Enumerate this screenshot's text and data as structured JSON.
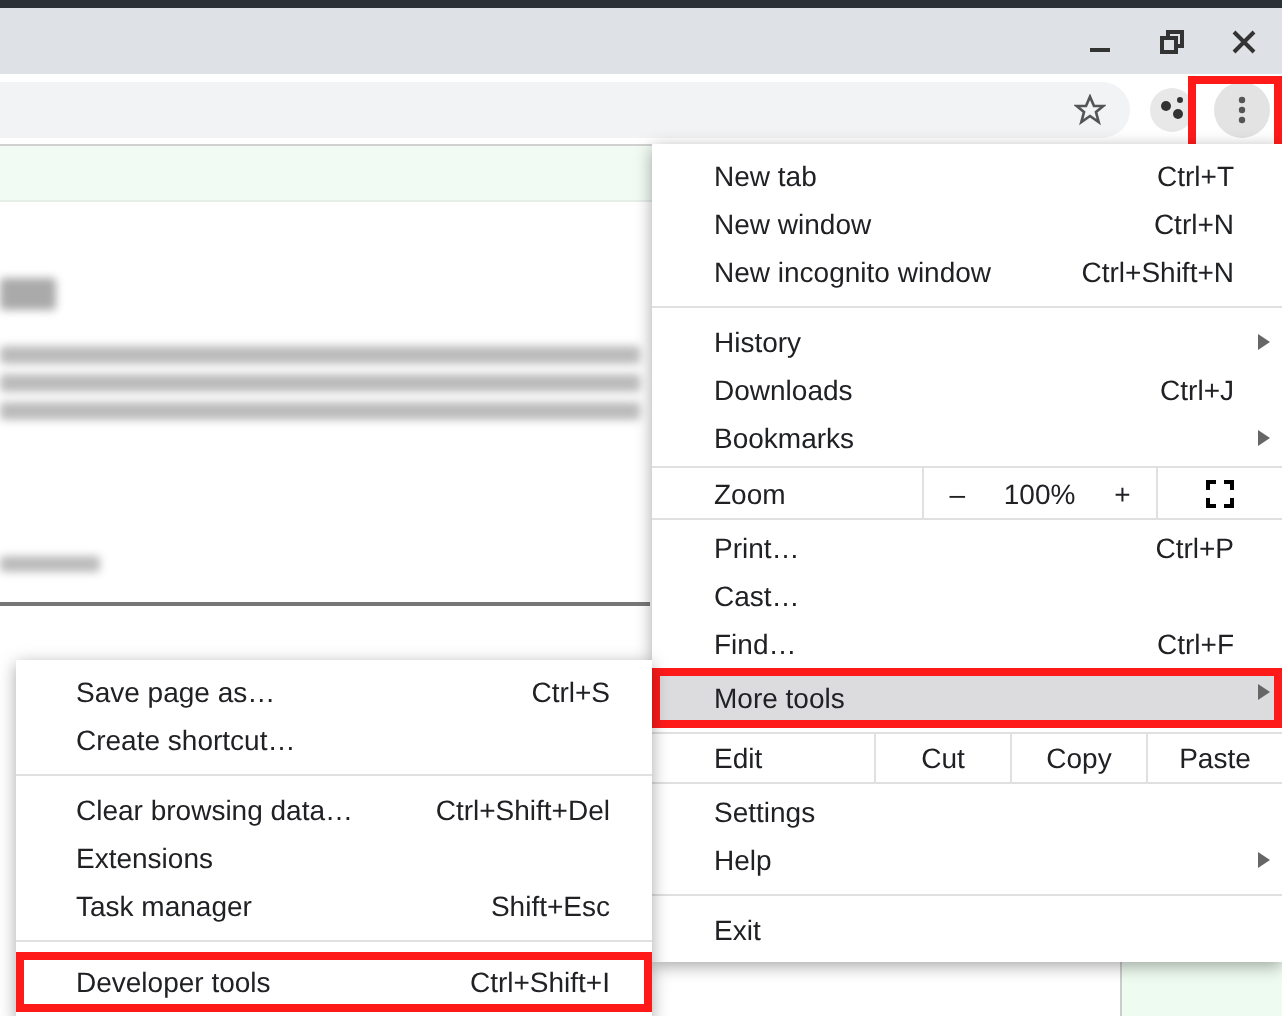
{
  "toolbar": {
    "menu_button_annotated": true
  },
  "menu": {
    "items": [
      {
        "kind": "item",
        "label": "New tab",
        "shortcut": "Ctrl+T",
        "has_submenu": false,
        "highlighted": false,
        "annotated": false
      },
      {
        "kind": "item",
        "label": "New window",
        "shortcut": "Ctrl+N",
        "has_submenu": false,
        "highlighted": false,
        "annotated": false
      },
      {
        "kind": "item",
        "label": "New incognito window",
        "shortcut": "Ctrl+Shift+N",
        "has_submenu": false,
        "highlighted": false,
        "annotated": false
      },
      {
        "kind": "separator"
      },
      {
        "kind": "item",
        "label": "History",
        "has_submenu": true,
        "highlighted": false,
        "annotated": false
      },
      {
        "kind": "item",
        "label": "Downloads",
        "shortcut": "Ctrl+J",
        "has_submenu": false,
        "highlighted": false,
        "annotated": false
      },
      {
        "kind": "item",
        "label": "Bookmarks",
        "has_submenu": true,
        "highlighted": false,
        "annotated": false
      },
      {
        "kind": "zoom",
        "label": "Zoom",
        "minus": "–",
        "value": "100%",
        "plus": "+"
      },
      {
        "kind": "item",
        "label": "Print…",
        "shortcut": "Ctrl+P",
        "has_submenu": false,
        "highlighted": false,
        "annotated": false
      },
      {
        "kind": "item",
        "label": "Cast…",
        "has_submenu": false,
        "highlighted": false,
        "annotated": false
      },
      {
        "kind": "item",
        "label": "Find…",
        "shortcut": "Ctrl+F",
        "has_submenu": false,
        "highlighted": false,
        "annotated": false
      },
      {
        "kind": "item",
        "label": "More tools",
        "has_submenu": true,
        "highlighted": true,
        "annotated": true
      },
      {
        "kind": "edit",
        "label": "Edit",
        "buttons": [
          "Cut",
          "Copy",
          "Paste"
        ]
      },
      {
        "kind": "item",
        "label": "Settings",
        "has_submenu": false,
        "highlighted": false,
        "annotated": false
      },
      {
        "kind": "item",
        "label": "Help",
        "has_submenu": true,
        "highlighted": false,
        "annotated": false
      },
      {
        "kind": "separator"
      },
      {
        "kind": "item",
        "label": "Exit",
        "has_submenu": false,
        "highlighted": false,
        "annotated": false
      }
    ]
  },
  "submenu": {
    "items": [
      {
        "kind": "item",
        "label": "Save page as…",
        "shortcut": "Ctrl+S",
        "highlighted": false,
        "annotated": false
      },
      {
        "kind": "item",
        "label": "Create shortcut…",
        "highlighted": false,
        "annotated": false
      },
      {
        "kind": "separator"
      },
      {
        "kind": "item",
        "label": "Clear browsing data…",
        "shortcut": "Ctrl+Shift+Del",
        "highlighted": false,
        "annotated": false
      },
      {
        "kind": "item",
        "label": "Extensions",
        "highlighted": false,
        "annotated": false
      },
      {
        "kind": "item",
        "label": "Task manager",
        "shortcut": "Shift+Esc",
        "highlighted": false,
        "annotated": false
      },
      {
        "kind": "separator"
      },
      {
        "kind": "item",
        "label": "Developer tools",
        "shortcut": "Ctrl+Shift+I",
        "highlighted": false,
        "annotated": true
      }
    ]
  }
}
